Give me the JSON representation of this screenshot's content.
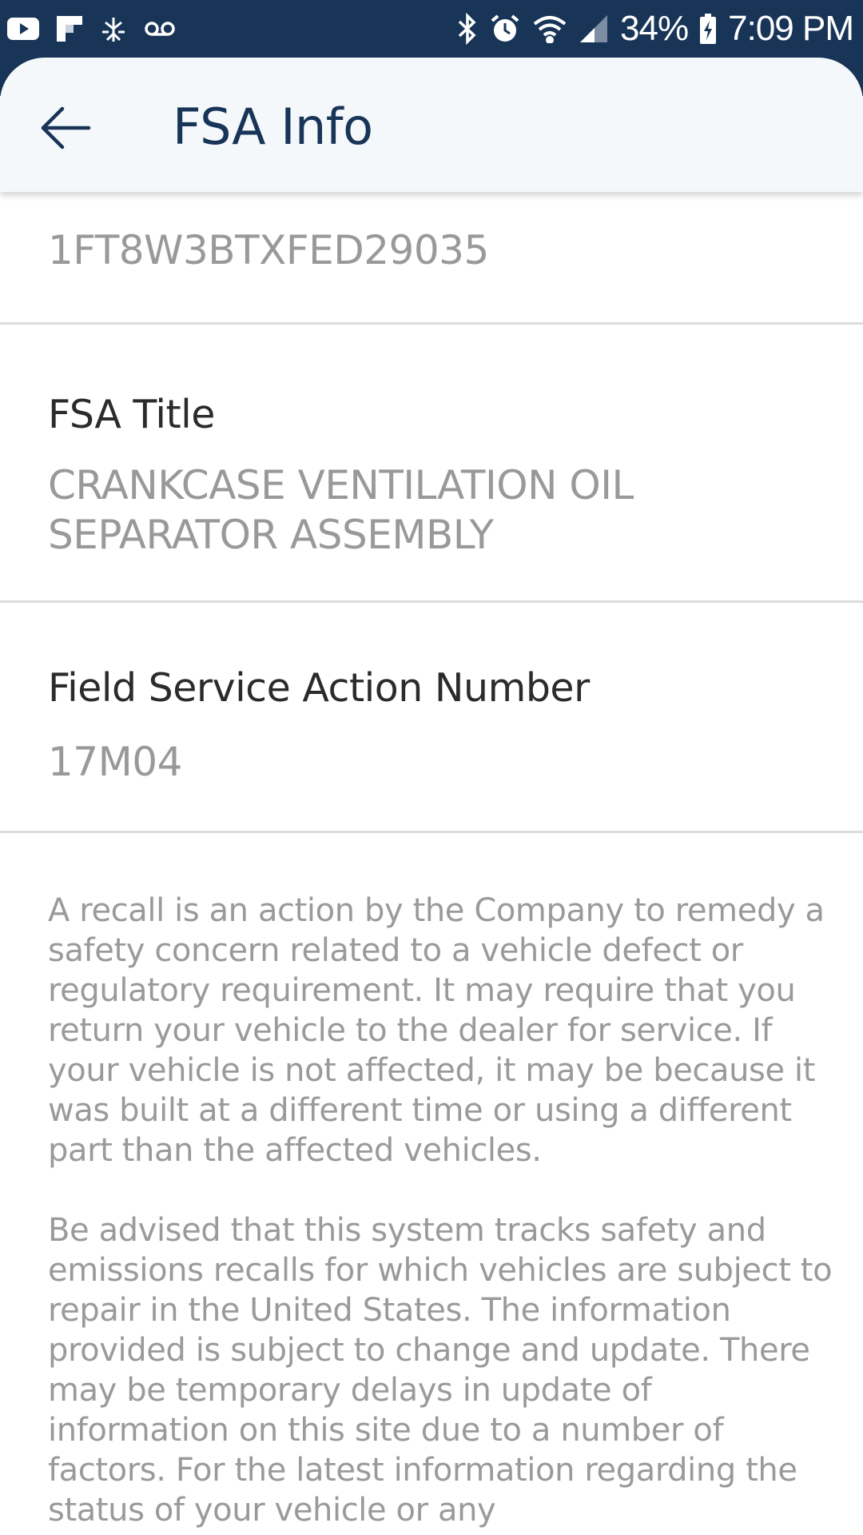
{
  "status_bar": {
    "notification_icons": [
      "youtube-icon",
      "flipboard-icon",
      "antenna-icon",
      "voicemail-icon"
    ],
    "system_icons": [
      "bluetooth-icon",
      "alarm-icon",
      "wifi-icon",
      "signal-icon"
    ],
    "battery_percent": "34%",
    "time": "7:09 PM",
    "background_color": "#183558"
  },
  "app_bar": {
    "back_icon": "arrow-left-icon",
    "title": "FSA Info",
    "title_color": "#183558"
  },
  "fields": {
    "vin": {
      "value": "1FT8W3BTXFED29035"
    },
    "fsa_title": {
      "label": "FSA Title",
      "value_line1": "CRANKCASE VENTILATION OIL",
      "value_line2": "SEPARATOR ASSEMBLY"
    },
    "fsa_number": {
      "label": "Field Service Action Number",
      "value": "17M04"
    }
  },
  "disclaimer": {
    "paragraph1": "A recall is an action by the Company to remedy a safety concern related to a vehicle defect or regulatory requirement. It may require that you return your vehicle to the dealer for service. If your vehicle is not affected, it may be because it was built at a different time or using a different part than the affected vehicles.",
    "paragraph2": "Be advised that this system tracks safety and emissions recalls for which vehicles are subject to repair in the United States. The information provided is subject to change and update. There may be temporary delays in update of information on this site due to a number of factors. For the latest information regarding the status of your vehicle or any"
  }
}
